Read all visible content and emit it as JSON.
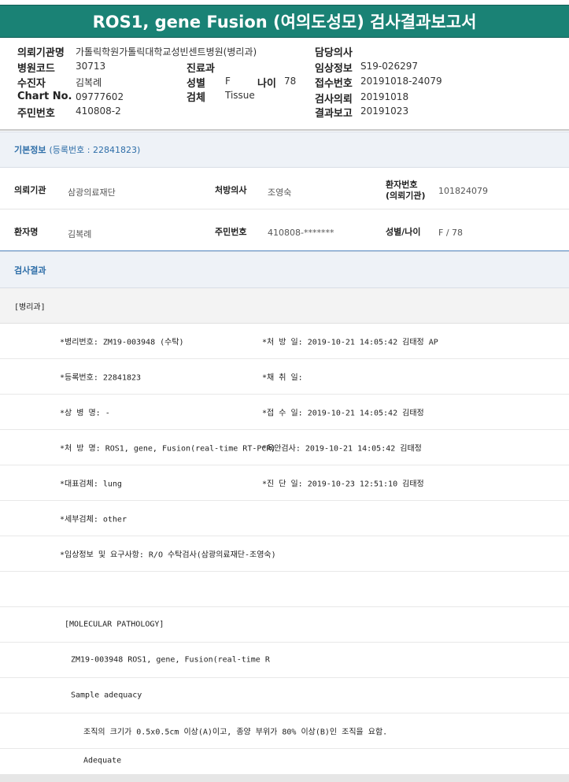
{
  "title": "ROS1, gene Fusion (여의도성모) 검사결과보고서",
  "header": {
    "req_inst_label": "의뢰기관명",
    "req_inst_value": "가톨릭학원가톨릭대학교성빈센트병원(병리과)",
    "doctor_label": "담당의사",
    "hosp_code_label": "병원코드",
    "hosp_code_value": "30713",
    "dept_label": "진료과",
    "clin_info_label": "임상정보",
    "clin_info_value": "S19-026297",
    "patient_label": "수진자",
    "patient_value": "김복례",
    "sex_label": "성별",
    "sex_value": "F",
    "age_label": "나이",
    "age_value": "78",
    "recv_no_label": "접수번호",
    "recv_no_value": "20191018-24079",
    "chart_label": "Chart No.",
    "chart_value": "09777602",
    "specimen_label": "검체",
    "specimen_value": "Tissue",
    "req_date_label": "검사의뢰",
    "req_date_value": "20191018",
    "id_label": "주민번호",
    "id_value": "410808-2",
    "report_label": "결과보고",
    "report_value": "20191023"
  },
  "basic": {
    "section_title": "기본정보",
    "reg_no": "(등록번호 : 22841823)",
    "req_inst_label": "의뢰기관",
    "req_inst_value": "삼광의료재단",
    "prescriber_label": "처방의사",
    "prescriber_value": "조영숙",
    "patient_no_label_1": "환자번호",
    "patient_no_label_2": "(의뢰기관)",
    "patient_no_value": "101824079",
    "patient_name_label": "환자명",
    "patient_name_value": "김복례",
    "id_label": "주민번호",
    "id_value": "410808-*******",
    "sex_age_label": "성별/나이",
    "sex_age_value": "F / 78"
  },
  "results": {
    "section_title": "검사결과",
    "dept": "[병리과]",
    "rows": [
      {
        "left": "*병리번호: ZM19-003948 (수탁)",
        "right": "*처 방 일: 2019-10-21 14:05:42  김태정 AP"
      },
      {
        "left": "*등록번호: 22841823",
        "right": "*채 취 일:"
      },
      {
        "left": "*상 병 명: -",
        "right": "*접 수 일: 2019-10-21 14:05:42  김태정"
      },
      {
        "left": "*처 방 명: ROS1, gene, Fusion(real-time RT-PCR)",
        "right": "*육안검사: 2019-10-21 14:05:42  김태정"
      },
      {
        "left": "*대표검체: lung",
        "right": "*진 단 일: 2019-10-23 12:51:10  김태정"
      },
      {
        "left": "*세부검체: other",
        "right": ""
      },
      {
        "left": "*임상정보 및 요구사항: R/O 수탁검사(삼광의료재단-조영숙)",
        "right": ""
      }
    ],
    "mol_heading": "[MOLECULAR PATHOLOGY]",
    "mol_line": "ZM19-003948      ROS1, gene, Fusion(real-time R",
    "adequacy_label": "Sample adequacy",
    "adequacy_note": "조직의 크기가 0.5x0.5cm 이상(A)이고, 종양 부위가 80% 이상(B)인 조직을 요함.",
    "adequacy_value": "Adequate"
  }
}
